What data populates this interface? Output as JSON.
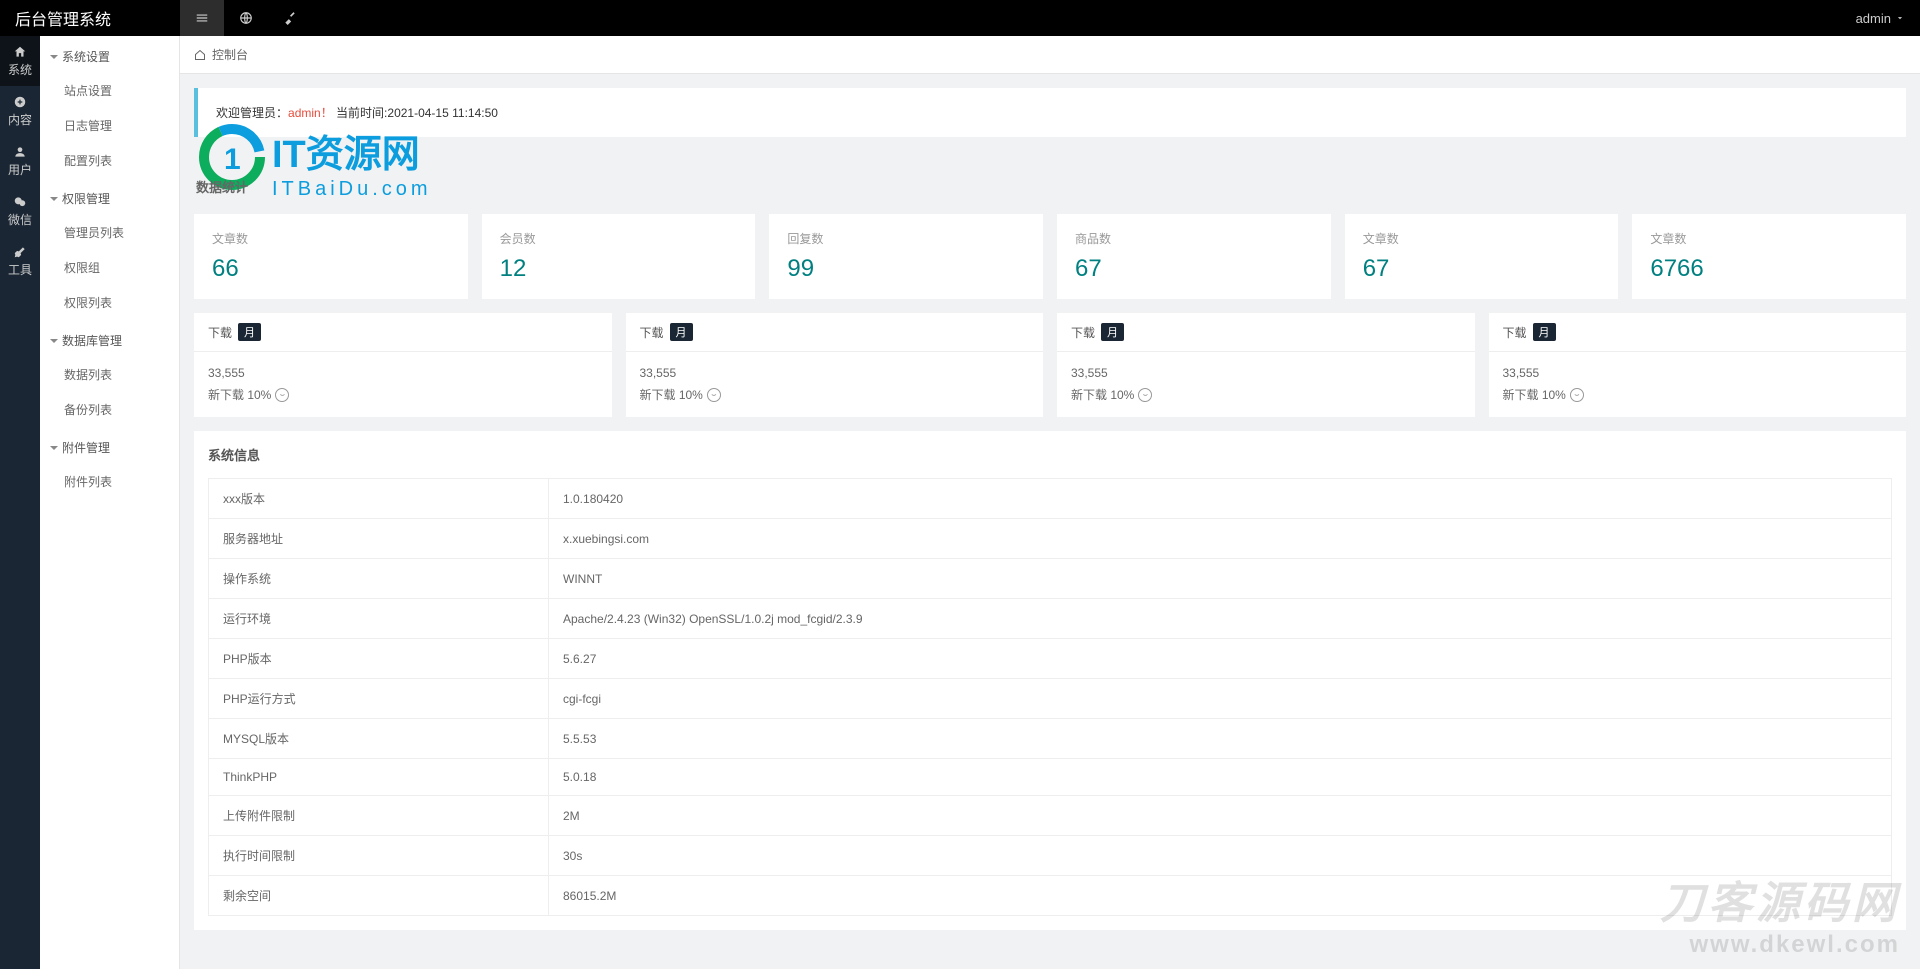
{
  "topbar": {
    "brand": "后台管理系统",
    "user": "admin"
  },
  "leftnav": [
    {
      "label": "系统"
    },
    {
      "label": "内容"
    },
    {
      "label": "用户"
    },
    {
      "label": "微信"
    },
    {
      "label": "工具"
    }
  ],
  "sidemenu": {
    "groups": [
      {
        "title": "系统设置",
        "items": [
          "站点设置",
          "日志管理",
          "配置列表"
        ]
      },
      {
        "title": "权限管理",
        "items": [
          "管理员列表",
          "权限组",
          "权限列表"
        ]
      },
      {
        "title": "数据库管理",
        "items": [
          "数据列表",
          "备份列表"
        ]
      },
      {
        "title": "附件管理",
        "items": [
          "附件列表"
        ]
      }
    ]
  },
  "breadcrumb": "控制台",
  "welcome": {
    "prefix": "欢迎管理员：",
    "name": "admin！",
    "time_label": "当前时间:",
    "time": "2021-04-15 11:14:50"
  },
  "stats": {
    "title": "数据统计",
    "cards": [
      {
        "label": "文章数",
        "value": "66"
      },
      {
        "label": "会员数",
        "value": "12"
      },
      {
        "label": "回复数",
        "value": "99"
      },
      {
        "label": "商品数",
        "value": "67"
      },
      {
        "label": "文章数",
        "value": "67"
      },
      {
        "label": "文章数",
        "value": "6766"
      }
    ]
  },
  "downloads": {
    "cards": [
      {
        "title": "下载",
        "badge": "月",
        "count": "33,555",
        "delta": "新下载 10%"
      },
      {
        "title": "下载",
        "badge": "月",
        "count": "33,555",
        "delta": "新下载 10%"
      },
      {
        "title": "下载",
        "badge": "月",
        "count": "33,555",
        "delta": "新下载 10%"
      },
      {
        "title": "下载",
        "badge": "月",
        "count": "33,555",
        "delta": "新下载 10%"
      }
    ]
  },
  "sysinfo": {
    "title": "系统信息",
    "rows": [
      {
        "k": "xxx版本",
        "v": "1.0.180420"
      },
      {
        "k": "服务器地址",
        "v": "x.xuebingsi.com"
      },
      {
        "k": "操作系统",
        "v": "WINNT"
      },
      {
        "k": "运行环境",
        "v": "Apache/2.4.23 (Win32) OpenSSL/1.0.2j mod_fcgid/2.3.9"
      },
      {
        "k": "PHP版本",
        "v": "5.6.27"
      },
      {
        "k": "PHP运行方式",
        "v": "cgi-fcgi"
      },
      {
        "k": "MYSQL版本",
        "v": "5.5.53"
      },
      {
        "k": "ThinkPHP",
        "v": "5.0.18"
      },
      {
        "k": "上传附件限制",
        "v": "2M"
      },
      {
        "k": "执行时间限制",
        "v": "30s"
      },
      {
        "k": "剩余空间",
        "v": "86015.2M"
      }
    ]
  },
  "watermark": {
    "logo_cn": "IT资源网",
    "logo_en": "ITBaiDu.com",
    "bottom_cn": "刀客源码网",
    "bottom_en": "www.dkewl.com"
  }
}
